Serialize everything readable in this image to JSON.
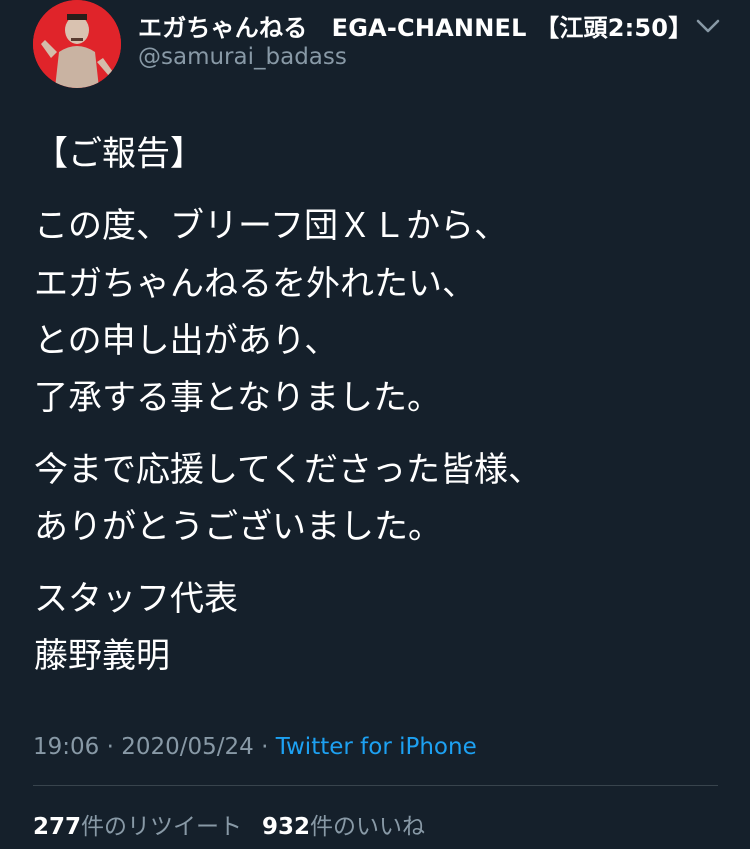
{
  "author": {
    "name": "エガちゃんねる　EGA-CHANNEL 【江頭2:50】",
    "handle": "@samurai_badass",
    "avatar_color": "#e0242a"
  },
  "tweet": {
    "lines": [
      "【ご報告】",
      "この度、ブリーフ団ＸＬから、",
      "エガちゃんねるを外れたい、",
      "との申し出があり、",
      "了承する事となりました。",
      "今まで応援してくださった皆様、",
      "ありがとうございました。",
      "スタッフ代表",
      "藤野義明"
    ],
    "time": "19:06",
    "date": "2020/05/24",
    "separator": " · ",
    "source": "Twitter for iPhone"
  },
  "stats": {
    "retweets_count": "277",
    "retweets_label": "件のリツイート",
    "likes_count": "932",
    "likes_label": "件のいいね"
  },
  "colors": {
    "background": "#15202b",
    "text": "#ffffff",
    "secondary": "#8899a6",
    "link": "#1da1f2"
  }
}
